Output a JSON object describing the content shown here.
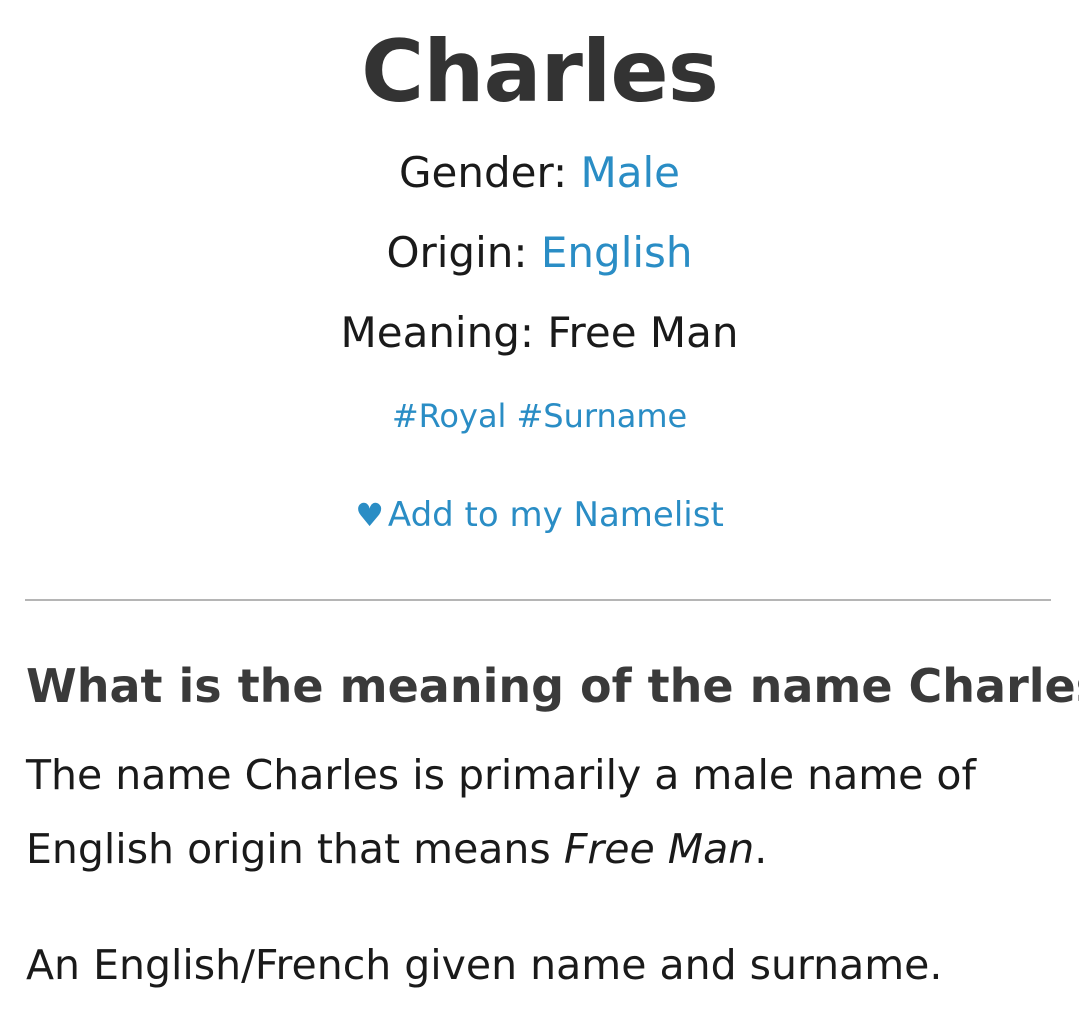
{
  "name": {
    "title": "Charles"
  },
  "details": {
    "gender_label": "Gender:",
    "gender_value": "Male",
    "origin_label": "Origin:",
    "origin_value": "English",
    "meaning_label": "Meaning:",
    "meaning_value": "Free Man"
  },
  "tags": [
    "#Royal",
    "#Surname"
  ],
  "namelist": {
    "icon": "heart-icon",
    "label": "Add to my Namelist"
  },
  "section": {
    "heading_prefix": "What is the meaning of the name ",
    "heading_name": "Charles",
    "heading_suffix": "?",
    "para1_start": "The name Charles is primarily a male name of English origin that means ",
    "para1_meaning": "Free Man",
    "para1_end": ".",
    "para2": "An English/French given name and surname."
  },
  "colors": {
    "link": "#2a8dc5",
    "title": "#333333",
    "divider": "#b5b5b5"
  }
}
